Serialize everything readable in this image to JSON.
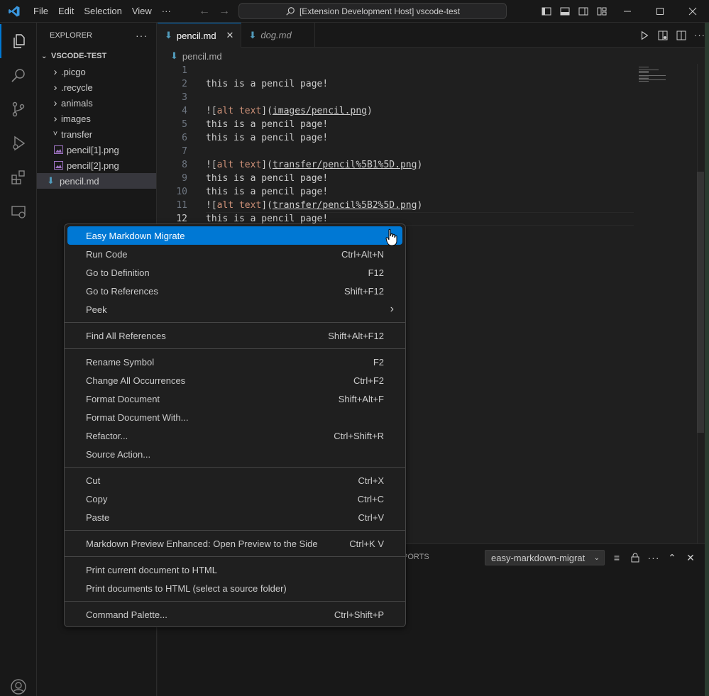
{
  "titlebar": {
    "menus": [
      "File",
      "Edit",
      "Selection",
      "View",
      "···"
    ],
    "command_center": "[Extension Development Host] vscode-test"
  },
  "sidebar": {
    "header": "EXPLORER",
    "section": "VSCODE-TEST",
    "items": [
      {
        "label": ".picgo",
        "type": "folder",
        "expanded": false
      },
      {
        "label": ".recycle",
        "type": "folder",
        "expanded": false
      },
      {
        "label": "animals",
        "type": "folder",
        "expanded": false
      },
      {
        "label": "images",
        "type": "folder",
        "expanded": false
      },
      {
        "label": "transfer",
        "type": "folder",
        "expanded": true
      },
      {
        "label": "pencil[1].png",
        "type": "image"
      },
      {
        "label": "pencil[2].png",
        "type": "image"
      },
      {
        "label": "pencil.md",
        "type": "markdown",
        "selected": true
      }
    ]
  },
  "tabs": [
    {
      "label": "pencil.md",
      "active": true
    },
    {
      "label": "dog.md",
      "active": false
    }
  ],
  "breadcrumb": "pencil.md",
  "editor": {
    "lines": [
      {
        "n": "1",
        "parts": []
      },
      {
        "n": "2",
        "parts": [
          {
            "t": "this is a pencil page!"
          }
        ]
      },
      {
        "n": "3",
        "parts": []
      },
      {
        "n": "4",
        "parts": [
          {
            "t": "!["
          },
          {
            "t": "alt text",
            "c": "alt"
          },
          {
            "t": "]("
          },
          {
            "t": "images/pencil.png",
            "c": "link"
          },
          {
            "t": ")"
          }
        ]
      },
      {
        "n": "5",
        "parts": [
          {
            "t": "this is a pencil page!"
          }
        ]
      },
      {
        "n": "6",
        "parts": [
          {
            "t": "this is a pencil page!"
          }
        ]
      },
      {
        "n": "7",
        "parts": []
      },
      {
        "n": "8",
        "parts": [
          {
            "t": "!["
          },
          {
            "t": "alt text",
            "c": "alt"
          },
          {
            "t": "]("
          },
          {
            "t": "transfer/pencil%5B1%5D.png",
            "c": "link"
          },
          {
            "t": ")"
          }
        ]
      },
      {
        "n": "9",
        "parts": [
          {
            "t": "this is a pencil page!"
          }
        ]
      },
      {
        "n": "10",
        "parts": [
          {
            "t": "this is a pencil page!"
          }
        ]
      },
      {
        "n": "11",
        "parts": [
          {
            "t": "!["
          },
          {
            "t": "alt text",
            "c": "alt"
          },
          {
            "t": "]("
          },
          {
            "t": "transfer/pencil%5B2%5D.png",
            "c": "link"
          },
          {
            "t": ")"
          }
        ]
      },
      {
        "n": "12",
        "parts": [
          {
            "t": "this is a pencil page!"
          }
        ],
        "current": true
      }
    ]
  },
  "panel": {
    "tab_fragment": "PORTS",
    "output_channel": "easy-markdown-migrat"
  },
  "context_menu": {
    "groups": [
      [
        {
          "label": "Easy Markdown Migrate",
          "shortcut": "",
          "highlighted": true
        },
        {
          "label": "Run Code",
          "shortcut": "Ctrl+Alt+N"
        },
        {
          "label": "Go to Definition",
          "shortcut": "F12"
        },
        {
          "label": "Go to References",
          "shortcut": "Shift+F12"
        },
        {
          "label": "Peek",
          "shortcut": "",
          "submenu": true
        }
      ],
      [
        {
          "label": "Find All References",
          "shortcut": "Shift+Alt+F12"
        }
      ],
      [
        {
          "label": "Rename Symbol",
          "shortcut": "F2"
        },
        {
          "label": "Change All Occurrences",
          "shortcut": "Ctrl+F2"
        },
        {
          "label": "Format Document",
          "shortcut": "Shift+Alt+F"
        },
        {
          "label": "Format Document With...",
          "shortcut": ""
        },
        {
          "label": "Refactor...",
          "shortcut": "Ctrl+Shift+R"
        },
        {
          "label": "Source Action...",
          "shortcut": ""
        }
      ],
      [
        {
          "label": "Cut",
          "shortcut": "Ctrl+X"
        },
        {
          "label": "Copy",
          "shortcut": "Ctrl+C"
        },
        {
          "label": "Paste",
          "shortcut": "Ctrl+V"
        }
      ],
      [
        {
          "label": "Markdown Preview Enhanced: Open Preview to the Side",
          "shortcut": "Ctrl+K V"
        }
      ],
      [
        {
          "label": "Print current document to HTML",
          "shortcut": ""
        },
        {
          "label": "Print documents to HTML (select a source folder)",
          "shortcut": ""
        }
      ],
      [
        {
          "label": "Command Palette...",
          "shortcut": "Ctrl+Shift+P"
        }
      ]
    ]
  },
  "colors": {
    "accent": "#0078d4",
    "background": "#1f1f1f",
    "sidebar": "#181818",
    "alt_text": "#ce9178",
    "markdown_icon": "#519aba",
    "image_icon": "#a074c4"
  }
}
